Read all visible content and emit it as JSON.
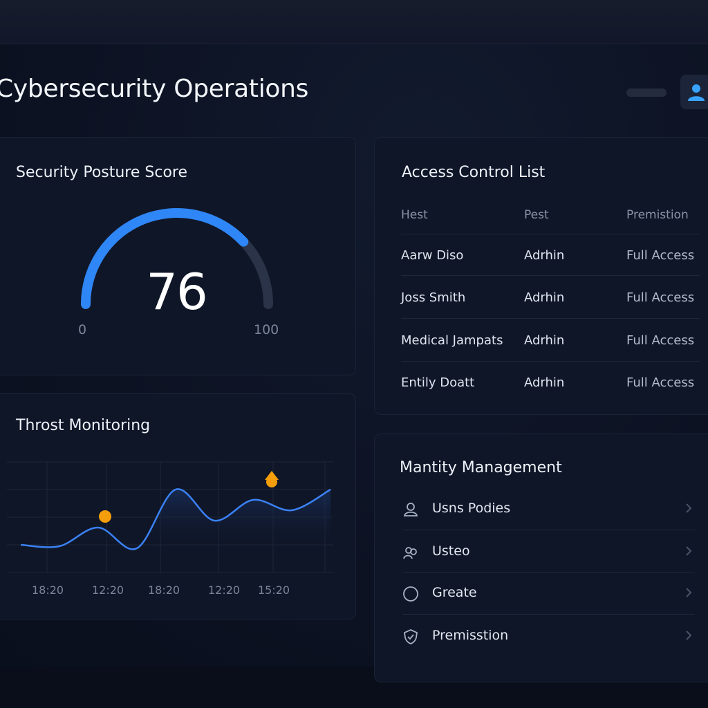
{
  "header": {
    "title": "Cybersecurity Operations"
  },
  "posture": {
    "title": "Security Posture Score",
    "score": "76",
    "score_value": 76,
    "min_label": "0",
    "max_label": "100",
    "gauge_color": "#2f86f6",
    "track_color": "#2a3347"
  },
  "acl": {
    "title": "Access Control List",
    "columns": [
      "Hest",
      "Pest",
      "Premistion"
    ],
    "rows": [
      [
        "Aarw Diso",
        "Adrhin",
        "Full Access"
      ],
      [
        "Joss Smith",
        "Adrhin",
        "Full Access"
      ],
      [
        "Medical Jampats",
        "Adrhin",
        "Full Access"
      ],
      [
        "Entily Doatt",
        "Adrhin",
        "Full Access"
      ]
    ]
  },
  "threat": {
    "title": "Throst Monitoring",
    "x_labels": [
      "18:20",
      "12:20",
      "18:20",
      "12:20",
      "15:20"
    ],
    "line_color": "#3b82f6",
    "marker_color": "#f59e0b"
  },
  "identity": {
    "title": "Mantity Management",
    "items": [
      {
        "label": "Usns Podies",
        "icon": "user-icon"
      },
      {
        "label": "Usteo",
        "icon": "users-group-icon"
      },
      {
        "label": "Greate",
        "icon": "circle-icon"
      },
      {
        "label": "Premisstion",
        "icon": "shield-check-icon"
      }
    ]
  },
  "chart_data": {
    "type": "line",
    "title": "Throst Monitoring",
    "categories": [
      "18:20",
      "12:20",
      "18:20",
      "12:20",
      "15:20"
    ],
    "series": [
      {
        "values": [
          0.1,
          0.08,
          0.35,
          0.05,
          0.9,
          0.45,
          0.75,
          0.6,
          0.9
        ]
      }
    ],
    "annotations": [
      "alert-dot",
      "alert-triangle"
    ],
    "grid": true
  }
}
